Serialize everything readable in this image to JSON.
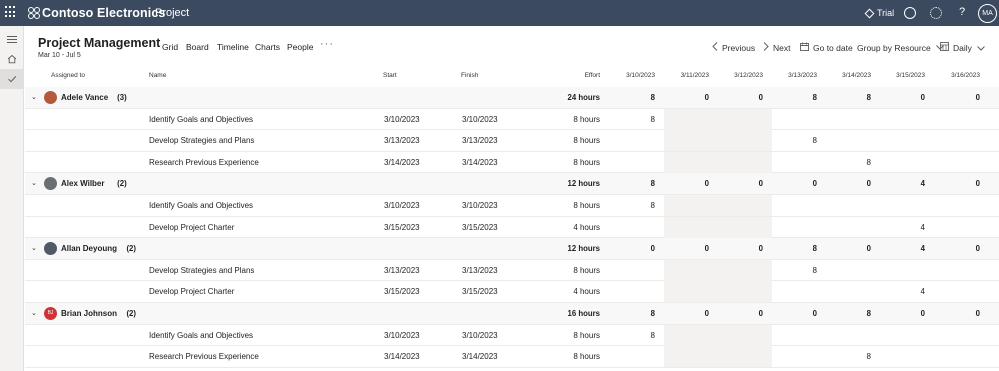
{
  "app": {
    "brand": "Contoso Electronics",
    "name": "Project",
    "trial_label": "Trial",
    "user_initials": "MA",
    "topbar_icons": [
      "waffle-icon",
      "smiley-icon",
      "gear-icon",
      "help-icon"
    ],
    "help_glyph": "?",
    "colors": {
      "topbar": "#3b4a5e",
      "rail": "#f3f2f1",
      "group_row": "#f8f8f8",
      "weekend_shade": "#f3f2f1"
    }
  },
  "header": {
    "title": "Project Management",
    "date_range": "Mar 10 - Jul 5",
    "tabs": [
      {
        "label": "Grid"
      },
      {
        "label": "Board"
      },
      {
        "label": "Timeline"
      },
      {
        "label": "Charts"
      },
      {
        "label": "People"
      }
    ],
    "more_glyph": "···",
    "commands": {
      "previous": "Previous",
      "next": "Next",
      "go_to_date": "Go to date",
      "group_by": "Group by Resource",
      "scale": "Daily"
    }
  },
  "columns": {
    "assigned": "Assigned to",
    "name": "Name",
    "start": "Start",
    "finish": "Finish",
    "effort": "Effort",
    "dates": [
      "3/10/2023",
      "3/11/2023",
      "3/12/2023",
      "3/13/2023",
      "3/14/2023",
      "3/15/2023",
      "3/16/2023"
    ]
  },
  "groups": [
    {
      "name": "Adele Vance",
      "count": "(3)",
      "avatar_color": "#b4593c",
      "initials": "",
      "effort": "24 hours",
      "daily": [
        "8",
        "0",
        "0",
        "8",
        "8",
        "0",
        "0"
      ],
      "tasks": [
        {
          "name": "Identify Goals and Objectives",
          "start": "3/10/2023",
          "finish": "3/10/2023",
          "effort": "8 hours",
          "daily": [
            "8",
            "",
            "",
            "",
            "",
            "",
            ""
          ]
        },
        {
          "name": "Develop Strategies and Plans",
          "start": "3/13/2023",
          "finish": "3/13/2023",
          "effort": "8 hours",
          "daily": [
            "",
            "",
            "",
            "8",
            "",
            "",
            ""
          ]
        },
        {
          "name": "Research Previous Experience",
          "start": "3/14/2023",
          "finish": "3/14/2023",
          "effort": "8 hours",
          "daily": [
            "",
            "",
            "",
            "",
            "8",
            "",
            ""
          ]
        }
      ]
    },
    {
      "name": "Alex Wilber",
      "count": "(2)",
      "avatar_color": "#6b6f73",
      "initials": "",
      "effort": "12 hours",
      "daily": [
        "8",
        "0",
        "0",
        "0",
        "0",
        "4",
        "0"
      ],
      "tasks": [
        {
          "name": "Identify Goals and Objectives",
          "start": "3/10/2023",
          "finish": "3/10/2023",
          "effort": "8 hours",
          "daily": [
            "8",
            "",
            "",
            "",
            "",
            "",
            ""
          ]
        },
        {
          "name": "Develop Project Charter",
          "start": "3/15/2023",
          "finish": "3/15/2023",
          "effort": "4 hours",
          "daily": [
            "",
            "",
            "",
            "",
            "",
            "4",
            ""
          ]
        }
      ]
    },
    {
      "name": "Allan Deyoung",
      "count": "(2)",
      "avatar_color": "#505a64",
      "initials": "",
      "effort": "12 hours",
      "daily": [
        "0",
        "0",
        "0",
        "8",
        "0",
        "4",
        "0"
      ],
      "tasks": [
        {
          "name": "Develop Strategies and Plans",
          "start": "3/13/2023",
          "finish": "3/13/2023",
          "effort": "8 hours",
          "daily": [
            "",
            "",
            "",
            "8",
            "",
            "",
            ""
          ]
        },
        {
          "name": "Develop Project Charter",
          "start": "3/15/2023",
          "finish": "3/15/2023",
          "effort": "4 hours",
          "daily": [
            "",
            "",
            "",
            "",
            "",
            "4",
            ""
          ]
        }
      ]
    },
    {
      "name": "Brian Johnson",
      "count": "(2)",
      "avatar_color": "#d13438",
      "initials": "BJ",
      "effort": "16 hours",
      "daily": [
        "8",
        "0",
        "0",
        "0",
        "8",
        "0",
        "0"
      ],
      "tasks": [
        {
          "name": "Identify Goals and Objectives",
          "start": "3/10/2023",
          "finish": "3/10/2023",
          "effort": "8 hours",
          "daily": [
            "8",
            "",
            "",
            "",
            "",
            "",
            ""
          ]
        },
        {
          "name": "Research Previous Experience",
          "start": "3/14/2023",
          "finish": "3/14/2023",
          "effort": "8 hours",
          "daily": [
            "",
            "",
            "",
            "",
            "8",
            "",
            ""
          ]
        }
      ]
    }
  ]
}
